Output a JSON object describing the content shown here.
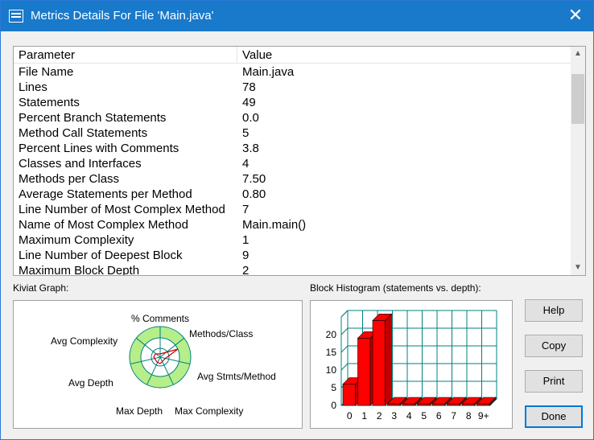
{
  "window": {
    "title": "Metrics Details For File 'Main.java'"
  },
  "table": {
    "headers": [
      "Parameter",
      "Value"
    ],
    "rows": [
      [
        "File Name",
        "Main.java"
      ],
      [
        "Lines",
        "78"
      ],
      [
        "Statements",
        "49"
      ],
      [
        "Percent Branch Statements",
        "0.0"
      ],
      [
        "Method Call Statements",
        "5"
      ],
      [
        "Percent Lines with Comments",
        "3.8"
      ],
      [
        "Classes and Interfaces",
        "4"
      ],
      [
        "Methods per Class",
        "7.50"
      ],
      [
        "Average Statements per Method",
        "0.80"
      ],
      [
        "Line Number of Most Complex Method",
        "7"
      ],
      [
        "Name of Most Complex Method",
        "Main.main()"
      ],
      [
        "Maximum Complexity",
        "1"
      ],
      [
        "Line Number of Deepest Block",
        "9"
      ],
      [
        "Maximum Block Depth",
        "2"
      ]
    ]
  },
  "kiviat": {
    "label": "Kiviat Graph:",
    "axes": [
      "% Comments",
      "Methods/Class",
      "Avg Stmts/Method",
      "Max Complexity",
      "Max Depth",
      "Avg Depth",
      "Avg Complexity"
    ]
  },
  "histogram": {
    "label": "Block Histogram (statements vs. depth):",
    "bar_color": "#ff0000",
    "grid_color": "#008080"
  },
  "buttons": {
    "help": "Help",
    "copy": "Copy",
    "print": "Print",
    "done": "Done"
  },
  "chart_data": {
    "type": "bar",
    "title": "Block Histogram (statements vs. depth):",
    "categories": [
      "0",
      "1",
      "2",
      "3",
      "4",
      "5",
      "6",
      "7",
      "8",
      "9+"
    ],
    "values": [
      6,
      19,
      24,
      0,
      0,
      0,
      0,
      0,
      0,
      0
    ],
    "ylim": [
      0,
      25
    ],
    "yticks": [
      0,
      5,
      10,
      15,
      20
    ],
    "grid": true
  }
}
